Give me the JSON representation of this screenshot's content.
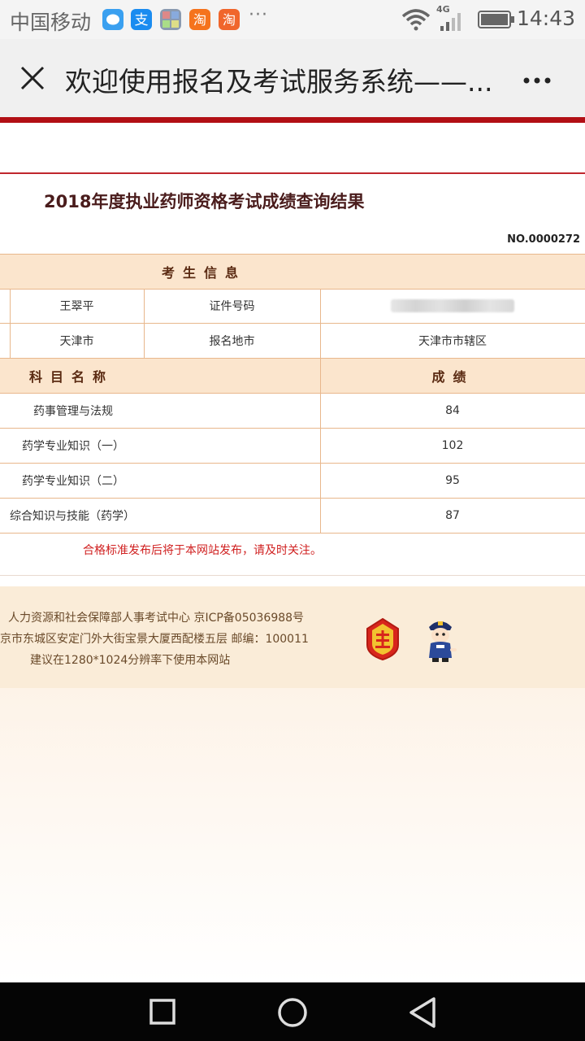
{
  "statusbar": {
    "carrier": "中国移动",
    "more": "···",
    "network": "4G",
    "time": "14:43",
    "app_icons": [
      "message-icon",
      "alipay-icon",
      "photo-icon",
      "taobao-icon",
      "taobao-icon"
    ]
  },
  "navbar": {
    "title": "欢迎使用报名及考试服务系统——..."
  },
  "page": {
    "title": "2018年度执业药师资格考试成绩查询结果",
    "serial": "NO.0000272"
  },
  "candidate": {
    "section_header": "考生信息",
    "name": "王翠平",
    "id_label": "证件号码",
    "city": "天津市",
    "reg_label": "报名地市",
    "reg_value": "天津市市辖区"
  },
  "scores": {
    "subject_header": "科目名称",
    "score_header": "成绩",
    "rows": [
      {
        "subject": "药事管理与法规",
        "score": "84"
      },
      {
        "subject": "药学专业知识（一）",
        "score": "102"
      },
      {
        "subject": "药学专业知识（二）",
        "score": "95"
      },
      {
        "subject": "综合知识与技能（药学）",
        "score": "87"
      }
    ]
  },
  "notice": "合格标准发布后将于本网站发布，请及时关注。",
  "footer": {
    "line1": "人力资源和社会保障部人事考试中心 京ICP备05036988号",
    "line2": "京市东城区安定门外大街宝景大厦西配楼五层 邮编：100011",
    "line3": "建议在1280*1024分辨率下使用本网站"
  },
  "colors": {
    "brand_red": "#b20f15",
    "table_header_bg": "#fbe5cd",
    "notice_red": "#d02020",
    "footer_bg": "#faecd8"
  }
}
